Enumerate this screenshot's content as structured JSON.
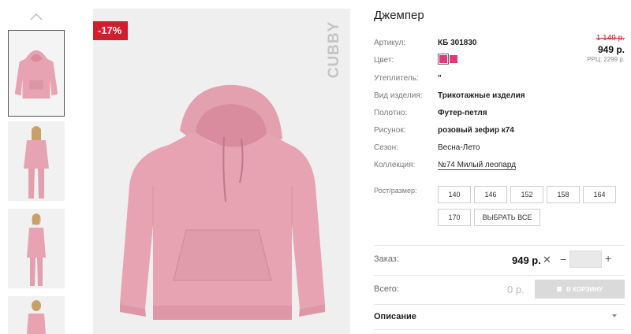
{
  "gallery": {
    "sale_badge": "-17%",
    "brand": "CUBBY",
    "thumbnails": [
      "hoodie",
      "model-front",
      "model-side",
      "model-back"
    ]
  },
  "product": {
    "title": "Джемпер",
    "rows": [
      {
        "label": "Артикул:",
        "value": "КБ 301830"
      },
      {
        "label": "Цвет:",
        "value": ""
      },
      {
        "label": "Утеплитель:",
        "value": "\""
      },
      {
        "label": "Вид изделия:",
        "value": "Трикотажные изделия"
      },
      {
        "label": "Полотно:",
        "value": "Футер-петля"
      },
      {
        "label": "Рисунок:",
        "value": "розовый зефир к74"
      },
      {
        "label": "Сезон:",
        "value": "Весна-Лето"
      },
      {
        "label": "Коллекция:",
        "value": "№74 Милый леопард"
      }
    ],
    "colors": [
      "#e8367a",
      "#e8367a"
    ]
  },
  "pricing": {
    "old_price": "1 149 р.",
    "price": "949 р.",
    "rrp": "РРЦ: 2299 р."
  },
  "sizes": {
    "label": "Рост/размер:",
    "options": [
      "140",
      "146",
      "152",
      "158",
      "164",
      "170"
    ],
    "select_all": "ВЫБРАТЬ ВСЕ"
  },
  "order": {
    "label": "Заказ:",
    "price": "949 р.",
    "remove": "✕",
    "minus": "−",
    "plus": "+",
    "quantity": ""
  },
  "total": {
    "label": "Всего:",
    "value": "0 р.",
    "cart_button": "В КОРЗИНУ"
  },
  "description": {
    "label": "Описание"
  },
  "colors": {
    "accent": "#d31c2c",
    "swatch": "#e8367a",
    "hoodie": "#e7a3b1"
  }
}
